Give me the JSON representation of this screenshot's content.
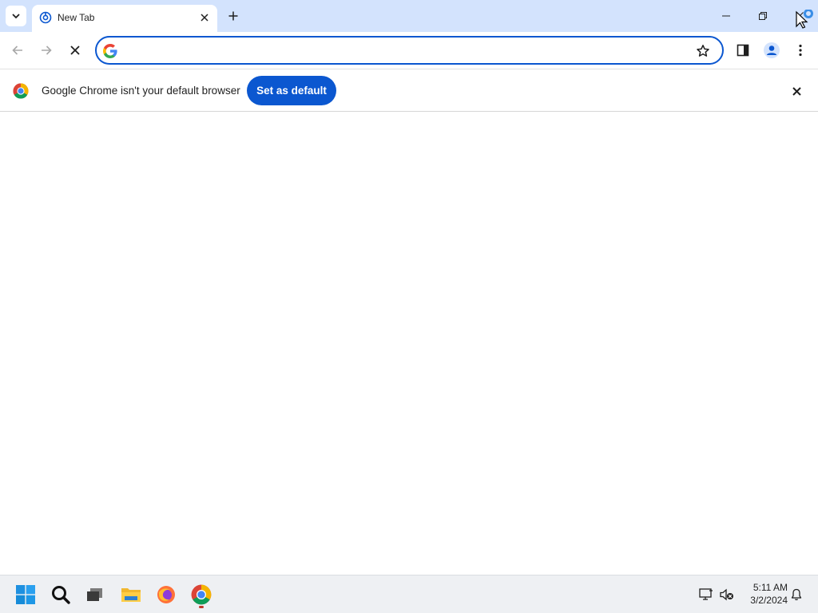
{
  "browser": {
    "tab": {
      "title": "New Tab",
      "favicon_icon": "chrome-new-tab-icon"
    },
    "window_controls": [
      "minimize-icon",
      "restore-icon",
      "close-icon"
    ],
    "toolbar": {
      "omnibox_value": "",
      "omnibox_icon": "google-g-icon",
      "back_icon": "back-arrow-icon",
      "forward_icon": "forward-arrow-icon",
      "stop_icon": "stop-loading-icon"
    },
    "infobar": {
      "message": "Google Chrome isn't your default browser",
      "button_label": "Set as default"
    }
  },
  "taskbar": {
    "apps": [
      "start-icon",
      "search-icon",
      "task-view-icon",
      "file-explorer-icon",
      "firefox-icon",
      "chrome-icon"
    ],
    "active_app": "chrome-icon",
    "clock": {
      "time": "5:11 AM",
      "date": "3/2/2024"
    }
  },
  "colors": {
    "titlebar": "#d3e3fd",
    "accent": "#0b57d0",
    "taskbar": "#eef0f3"
  }
}
